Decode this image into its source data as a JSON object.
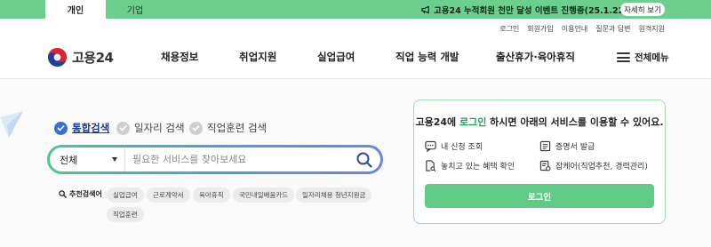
{
  "topbar": {
    "tabs": [
      "개인",
      "기업"
    ],
    "notice": "고용24 누적회원 천만 달성 이벤트 진행중(25.1.22~2.21)",
    "detail_button": "자세히 보기"
  },
  "util_links": [
    "로그인",
    "회원가입",
    "이용안내",
    "질문과 답변",
    "원격지원"
  ],
  "header": {
    "logo_text": "고용24",
    "nav": [
      "채용정보",
      "취업지원",
      "실업급여",
      "직업 능력 개발",
      "출산휴가·육아휴직"
    ],
    "all_menu": "전체메뉴"
  },
  "search": {
    "options": [
      "통합검색",
      "일자리 검색",
      "직업훈련 검색"
    ],
    "scope_value": "전체",
    "placeholder": "필요한 서비스를 찾아보세요",
    "recommended_label": "추천검색어",
    "recommended": [
      "실업급여",
      "근로계약서",
      "육아휴직",
      "국민내일배움카드",
      "일자리채용 청년지원금",
      "직업훈련"
    ]
  },
  "login_panel": {
    "msg_prefix": "고용24에 ",
    "msg_highlight": "로그인",
    "msg_suffix": " 하시면 아래의 서비스를 이용할 수 있어요.",
    "services": [
      "내 신청 조회",
      "증명서 발급",
      "놓치고 있는 혜택 확인",
      "잡케어(직업추천, 경력관리)"
    ],
    "login_button": "로그인"
  },
  "colors": {
    "brand_green": "#5fcb87",
    "banner_green": "#6ccf8e",
    "active_blue": "#3b6fd6"
  }
}
